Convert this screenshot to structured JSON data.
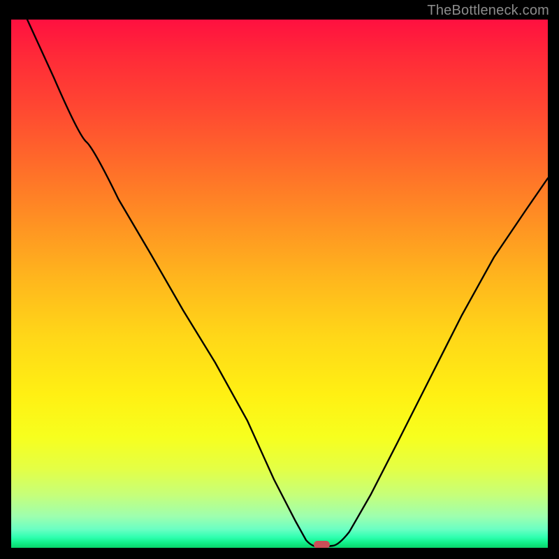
{
  "watermark": "TheBottleneck.com",
  "chart_data": {
    "type": "line",
    "title": "",
    "xlabel": "",
    "ylabel": "",
    "xlim": [
      0,
      100
    ],
    "ylim": [
      0,
      100
    ],
    "grid": false,
    "legend": false,
    "series": [
      {
        "name": "bottleneck-curve",
        "x": [
          3,
          8,
          14,
          20,
          26,
          32,
          38,
          44,
          49,
          53,
          55,
          57,
          58.5,
          60,
          63,
          67,
          72,
          78,
          84,
          90,
          96,
          100
        ],
        "y": [
          100,
          89,
          77,
          66,
          55.5,
          45,
          35,
          24,
          13,
          5,
          1.5,
          0.3,
          0.2,
          0.3,
          3,
          10,
          20,
          32,
          44,
          55,
          64,
          70
        ]
      }
    ],
    "marker": {
      "name": "optimal-point",
      "x": 57.5,
      "y": 0.6,
      "color": "#cc4e58"
    },
    "background_gradient": {
      "top": "#ff1040",
      "mid": "#fff013",
      "bottom": "#09d46b"
    }
  }
}
